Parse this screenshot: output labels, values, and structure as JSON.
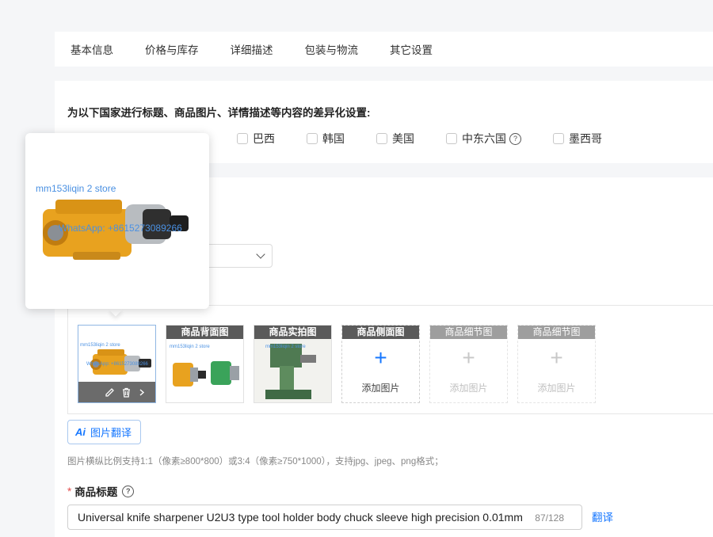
{
  "tabs": [
    "基本信息",
    "价格与库存",
    "详细描述",
    "包装与物流",
    "其它设置"
  ],
  "countries": {
    "title": "为以下国家进行标题、商品图片、详情描述等内容的差异化设置:",
    "items": [
      "巴西",
      "韩国",
      "美国",
      "中东六国",
      "墨西哥"
    ]
  },
  "images": {
    "slots": [
      {
        "label": "",
        "state": "filled"
      },
      {
        "label": "商品背面图",
        "state": "filled"
      },
      {
        "label": "商品实拍图",
        "state": "filled"
      },
      {
        "label": "商品侧面图",
        "state": "add",
        "add_text": "添加图片"
      },
      {
        "label": "商品细节图",
        "state": "disabled",
        "add_text": "添加图片"
      },
      {
        "label": "商品细节图",
        "state": "disabled",
        "add_text": "添加图片"
      }
    ],
    "watermark_line1": "mm153liqin 2 store",
    "watermark_line2": "WhatsApp: +8615273089266",
    "ai_badge": "Ai",
    "ai_translate_label": "图片翻译",
    "hint": "图片横纵比例支持1:1（像素≥800*800）或3:4（像素≥750*1000），支持jpg、jpeg、png格式；"
  },
  "product_title": {
    "required_mark": "*",
    "label": "商品标题",
    "value": "Universal knife sharpener U2U3 type tool holder body chuck sleeve high precision 0.01mm",
    "counter": "87/128",
    "translate": "翻译"
  },
  "colors": {
    "accent": "#1677ff",
    "required": "#e34d4d",
    "product_yellow": "#e8a21f"
  },
  "icons": [
    "help-icon",
    "edit-icon",
    "trash-icon",
    "chevron-right-icon",
    "chevron-down-icon",
    "plus-icon"
  ]
}
